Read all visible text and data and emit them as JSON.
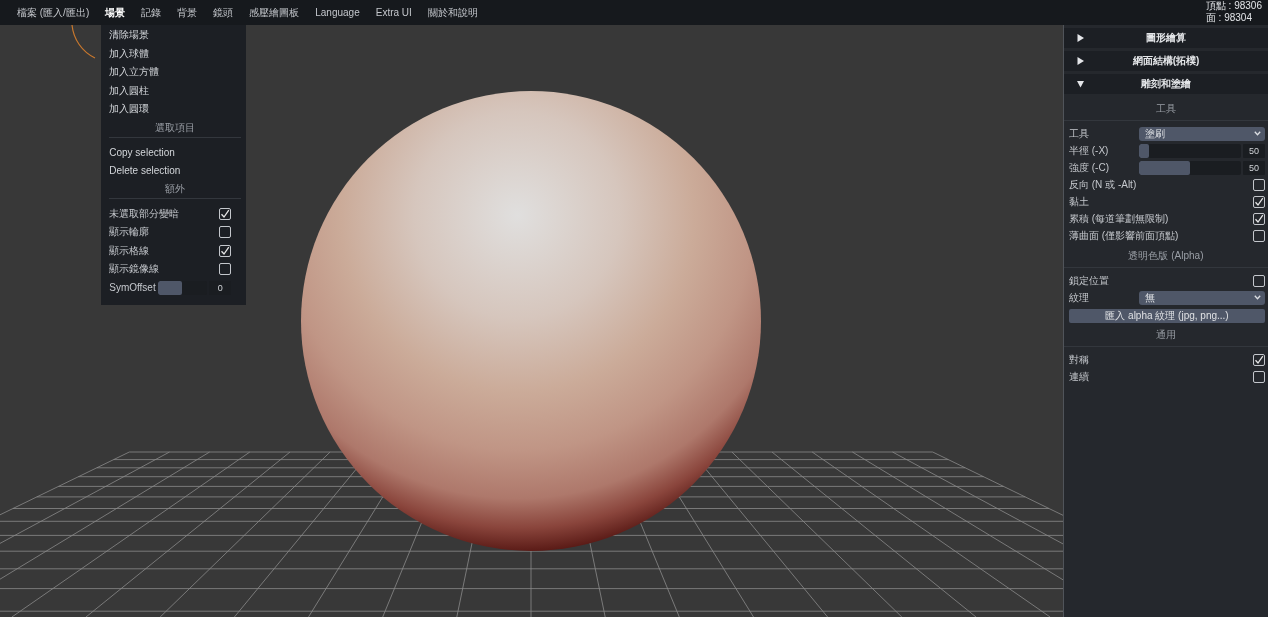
{
  "menu_bar": {
    "items": [
      {
        "label": "檔案 (匯入/匯出)",
        "selected": false
      },
      {
        "label": "場景",
        "selected": true
      },
      {
        "label": "記錄",
        "selected": false
      },
      {
        "label": "背景",
        "selected": false
      },
      {
        "label": "鏡頭",
        "selected": false
      },
      {
        "label": "感壓繪圖板",
        "selected": false
      },
      {
        "label": "Language",
        "selected": false
      },
      {
        "label": "Extra UI",
        "selected": false
      },
      {
        "label": "關於和說明",
        "selected": false
      }
    ],
    "stats": [
      "頂點 : 98306",
      "面 : 98304"
    ]
  },
  "scene_menu": {
    "items": [
      {
        "kind": "action",
        "label": "清除場景"
      },
      {
        "kind": "action",
        "label": "加入球體"
      },
      {
        "kind": "action",
        "label": "加入立方體"
      },
      {
        "kind": "action",
        "label": "加入圓柱"
      },
      {
        "kind": "action",
        "label": "加入圓環"
      },
      {
        "kind": "header",
        "label": "選取項目"
      },
      {
        "kind": "action",
        "label": "Copy selection"
      },
      {
        "kind": "action",
        "label": "Delete selection"
      },
      {
        "kind": "header",
        "label": "額外"
      },
      {
        "kind": "checkbox",
        "label": "未選取部分變暗",
        "checked": true
      },
      {
        "kind": "checkbox",
        "label": "顯示輪廓",
        "checked": false
      },
      {
        "kind": "checkbox",
        "label": "顯示格線",
        "checked": true
      },
      {
        "kind": "checkbox",
        "label": "顯示鏡像線",
        "checked": false
      },
      {
        "kind": "slider",
        "label": "SymOffset",
        "level": 0.5,
        "value": "0"
      }
    ]
  },
  "side_panel": {
    "folders": [
      {
        "title": "圖形繪算",
        "expanded": false
      },
      {
        "title": "網面結構(拓樸)",
        "expanded": false
      },
      {
        "title": "雕刻和塗繪",
        "expanded": true,
        "rows": [
          {
            "kind": "header",
            "label": "工具"
          },
          {
            "kind": "select",
            "label": "工具",
            "value": "塗刷"
          },
          {
            "kind": "slider",
            "label": "半徑 (-X)",
            "level": 0.1,
            "value": "50"
          },
          {
            "kind": "slider",
            "label": "強度 (-C)",
            "level": 0.5,
            "value": "50"
          },
          {
            "kind": "checkbox",
            "label": "反向 (N 或 -Alt)",
            "checked": false
          },
          {
            "kind": "checkbox",
            "label": "黏土",
            "checked": true
          },
          {
            "kind": "checkbox",
            "label": "累積 (每道筆劃無限制)",
            "checked": true
          },
          {
            "kind": "checkbox",
            "label": "薄曲面 (僅影響前面頂點)",
            "checked": false
          },
          {
            "kind": "header",
            "label": "透明色版 (Alpha)"
          },
          {
            "kind": "checkbox",
            "label": "鎖定位置",
            "checked": false
          },
          {
            "kind": "select",
            "label": "紋理",
            "value": "無"
          },
          {
            "kind": "button",
            "label": "匯入 alpha 紋理 (jpg, png...)"
          },
          {
            "kind": "header",
            "label": "通用"
          },
          {
            "kind": "checkbox",
            "label": "對稱",
            "checked": true
          },
          {
            "kind": "checkbox",
            "label": "連續",
            "checked": false
          }
        ]
      }
    ]
  }
}
